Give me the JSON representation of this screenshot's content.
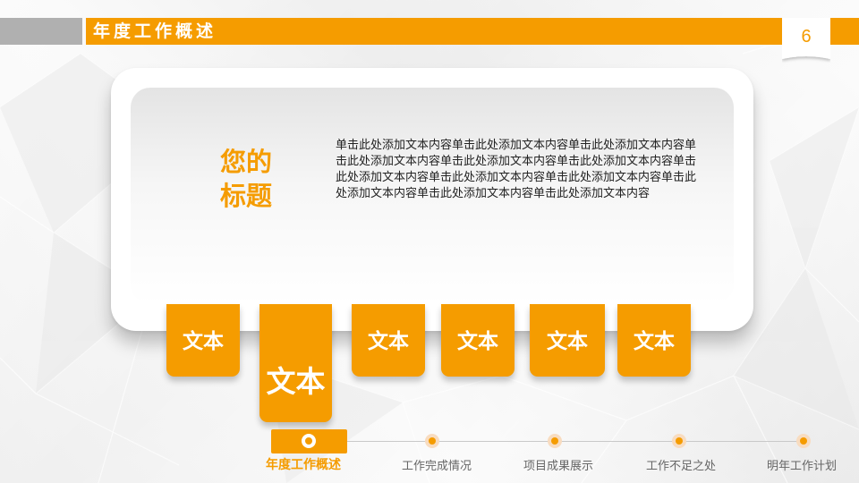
{
  "header": {
    "title": "年度工作概述",
    "page_number": "6"
  },
  "card": {
    "title": "您的标题",
    "body": "单击此处添加文本内容单击此处添加文本内容单击此处添加文本内容单击此处添加文本内容单击此处添加文本内容单击此处添加文本内容单击此处添加文本内容单击此处添加文本内容单击此处添加文本内容单击此处添加文本内容单击此处添加文本内容单击此处添加文本内容"
  },
  "tabs": [
    {
      "label": "文本"
    },
    {
      "label": "文本"
    },
    {
      "label": "文本"
    },
    {
      "label": "文本"
    },
    {
      "label": "文本"
    },
    {
      "label": "文本"
    }
  ],
  "timeline": [
    {
      "label": "年度工作概述"
    },
    {
      "label": "工作完成情况"
    },
    {
      "label": "项目成果展示"
    },
    {
      "label": "工作不足之处"
    },
    {
      "label": "明年工作计划"
    }
  ],
  "colors": {
    "accent": "#f59c00",
    "header_gray": "#b0b0b0",
    "text": "#222222"
  }
}
